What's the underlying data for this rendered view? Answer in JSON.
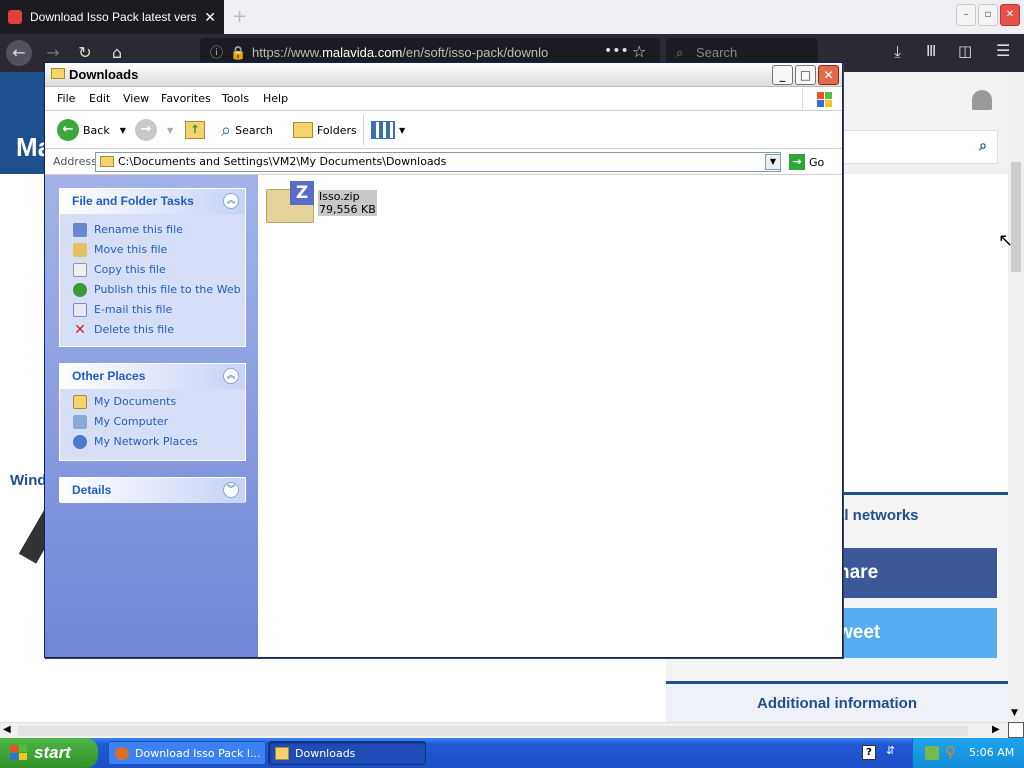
{
  "browser": {
    "tab_title": "Download Isso Pack latest version",
    "url_prefix": "https://www.",
    "url_domain": "malavida.com",
    "url_rest": "/en/soft/isso-pack/downlo",
    "search_placeholder": "Search"
  },
  "website": {
    "logo_text": "Ma",
    "side_text": "Wind",
    "social_title": "al networks",
    "share_label": "hare",
    "tweet_label": "weet",
    "additional_info": "Additional information",
    "colors": {
      "header": "#1e4f8f",
      "facebook": "#3b5998",
      "twitter": "#55acee"
    }
  },
  "explorer": {
    "title": "Downloads",
    "menu": [
      "File",
      "Edit",
      "View",
      "Favorites",
      "Tools",
      "Help"
    ],
    "toolbar": {
      "back": "Back",
      "search": "Search",
      "folders": "Folders"
    },
    "address_label": "Address",
    "address_value": "C:\\Documents and Settings\\VM2\\My Documents\\Downloads",
    "go_label": "Go",
    "file_tasks": {
      "title": "File and Folder Tasks",
      "items": [
        {
          "label": "Rename this file",
          "icon": "rename-icon"
        },
        {
          "label": "Move this file",
          "icon": "move-icon"
        },
        {
          "label": "Copy this file",
          "icon": "copy-icon"
        },
        {
          "label": "Publish this file to the Web",
          "icon": "globe-icon"
        },
        {
          "label": "E-mail this file",
          "icon": "email-icon"
        },
        {
          "label": "Delete this file",
          "icon": "delete-icon"
        }
      ]
    },
    "other_places": {
      "title": "Other Places",
      "items": [
        {
          "label": "My Documents",
          "icon": "my-documents-icon"
        },
        {
          "label": "My Computer",
          "icon": "my-computer-icon"
        },
        {
          "label": "My Network Places",
          "icon": "network-places-icon"
        }
      ]
    },
    "details": {
      "title": "Details"
    },
    "file": {
      "name": "Isso.zip",
      "size": "79,556 KB",
      "icon": "zip-archive-icon"
    }
  },
  "taskbar": {
    "start_label": "start",
    "tasks": [
      {
        "label": "Download Isso Pack l...",
        "icon": "firefox-icon",
        "active": false
      },
      {
        "label": "Downloads",
        "icon": "folder-icon",
        "active": true
      }
    ],
    "clock": "5:06 AM"
  }
}
